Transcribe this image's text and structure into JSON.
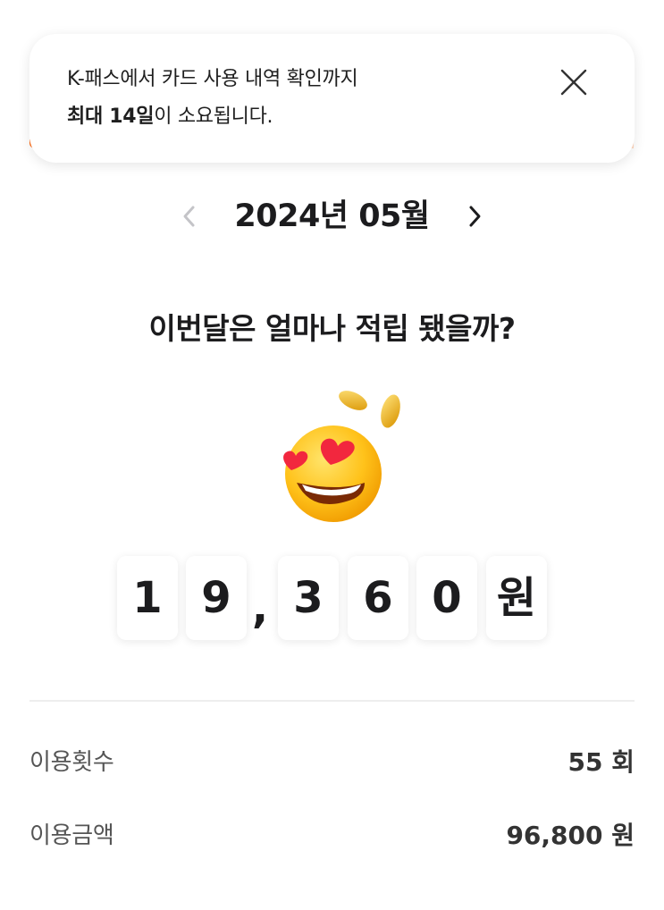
{
  "toast": {
    "line1": "K-패스에서 카드 사용 내역 확인까지",
    "line2_strong": "최대 14일",
    "line2_rest": "이 소요됩니다.",
    "close_icon": "close-icon"
  },
  "month_nav": {
    "label": "2024년 05월",
    "prev_icon": "chevron-left-icon",
    "next_icon": "chevron-right-icon"
  },
  "headline": "이번달은 얼마나 적립 됐을까?",
  "emoji": "heart-eyes-face-with-coins",
  "amount": {
    "digits": [
      "1",
      "9",
      "3",
      "6",
      "0"
    ],
    "comma": ",",
    "unit": "원"
  },
  "stats": {
    "usage_count_label": "이용횟수",
    "usage_count_value": "55 회",
    "usage_amount_label": "이용금액",
    "usage_amount_value": "96,800 원"
  },
  "colors": {
    "accent": "#ff6a13",
    "text_primary": "#1c1c1e",
    "text_secondary": "#555555",
    "divider": "#eeeeee"
  }
}
